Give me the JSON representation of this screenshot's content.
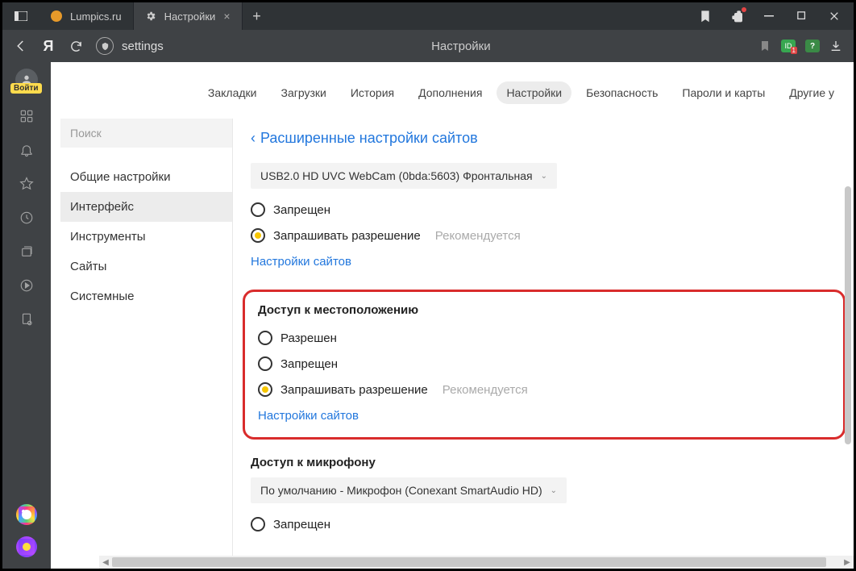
{
  "titlebar": {
    "tabs": [
      {
        "title": "Lumpics.ru"
      },
      {
        "title": "Настройки"
      }
    ]
  },
  "addrbar": {
    "yletter": "Я",
    "urlshield_text": "settings",
    "center_title": "Настройки"
  },
  "leftbar": {
    "login_label": "Войти"
  },
  "top_tabs": {
    "items": [
      "Закладки",
      "Загрузки",
      "История",
      "Дополнения",
      "Настройки",
      "Безопасность",
      "Пароли и карты",
      "Другие у"
    ],
    "active_index": 4
  },
  "sidebar": {
    "search_placeholder": "Поиск",
    "items": [
      "Общие настройки",
      "Интерфейс",
      "Инструменты",
      "Сайты",
      "Системные"
    ],
    "active_index": 1
  },
  "main": {
    "heading": "Расширенные настройки сайтов",
    "camera": {
      "dropdown": "USB2.0 HD UVC WebCam (0bda:5603) Фронтальная",
      "opt_denied": "Запрещен",
      "opt_ask": "Запрашивать разрешение",
      "hint": "Рекомендуется",
      "link": "Настройки сайтов"
    },
    "location": {
      "title": "Доступ к местоположению",
      "opt_allow": "Разрешен",
      "opt_denied": "Запрещен",
      "opt_ask": "Запрашивать разрешение",
      "hint": "Рекомендуется",
      "link": "Настройки сайтов"
    },
    "mic": {
      "title": "Доступ к микрофону",
      "dropdown": "По умолчанию - Микрофон (Conexant SmartAudio HD)",
      "opt_denied": "Запрещен"
    }
  }
}
